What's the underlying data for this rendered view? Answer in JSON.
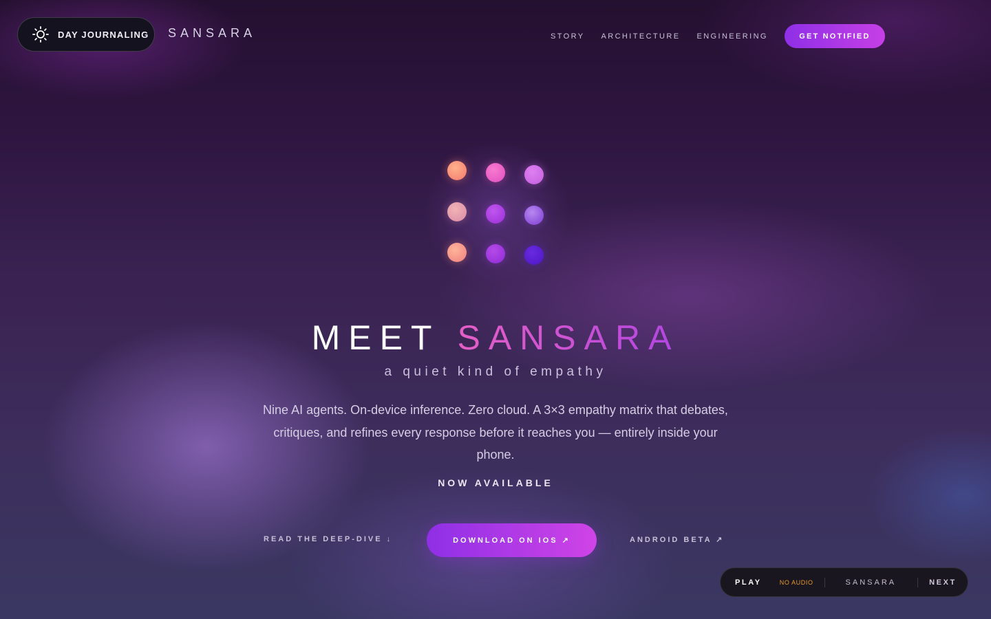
{
  "header": {
    "mode_toggle": {
      "label": "DAY JOURNALING",
      "icon": "sun-icon"
    },
    "brand": "SANSARA",
    "nav": [
      {
        "label": "STORY"
      },
      {
        "label": "ARCHITECTURE"
      },
      {
        "label": "ENGINEERING"
      }
    ],
    "cta": "GET NOTIFIED"
  },
  "hero": {
    "title_prefix": "MEET",
    "title_highlight": "SANSARA",
    "tagline": "a quiet kind of empathy",
    "description": "Nine AI agents. On-device inference. Zero cloud. A 3×3 empathy matrix that debates, critiques, and refines every response before it reaches you — entirely inside your phone.",
    "availability": "NOW AVAILABLE",
    "actions": {
      "deep_dive": "READ THE DEEP-DIVE ↓",
      "ios": "DOWNLOAD ON IOS ↗",
      "android": "ANDROID BETA ↗"
    }
  },
  "player": {
    "play": "PLAY",
    "status": "NO AUDIO",
    "track": "SANSARA",
    "next": "NEXT"
  },
  "colors": {
    "accent_start": "#8f2fe6",
    "accent_end": "#cf44e6",
    "highlight_text": "#d24fd3",
    "status_warning": "#e89a2a"
  }
}
